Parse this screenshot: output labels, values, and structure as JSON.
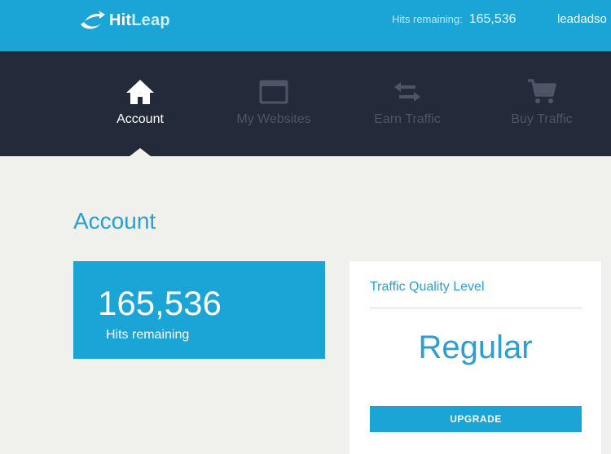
{
  "header": {
    "logo": {
      "part1": "Hit",
      "part2": "Leap"
    },
    "hits_label": "Hits remaining:",
    "hits_value": "165,536",
    "username": "leadadso"
  },
  "nav": {
    "items": [
      {
        "label": "Account",
        "icon": "home-icon",
        "active": true
      },
      {
        "label": "My Websites",
        "icon": "browser-window-icon",
        "active": false
      },
      {
        "label": "Earn Traffic",
        "icon": "exchange-arrows-icon",
        "active": false
      },
      {
        "label": "Buy Traffic",
        "icon": "shopping-cart-icon",
        "active": false
      }
    ]
  },
  "main": {
    "title": "Account",
    "hits_card": {
      "value": "165,536",
      "label": "Hits remaining"
    },
    "quality_card": {
      "title": "Traffic Quality Level",
      "level": "Regular",
      "button": "UPGRADE"
    }
  },
  "colors": {
    "brand": "#1aa5d6",
    "nav_bg": "#232a39",
    "page_bg": "#f0f0ec",
    "accent_text": "#2a9fd2",
    "nav_inactive": "#4d5566"
  }
}
